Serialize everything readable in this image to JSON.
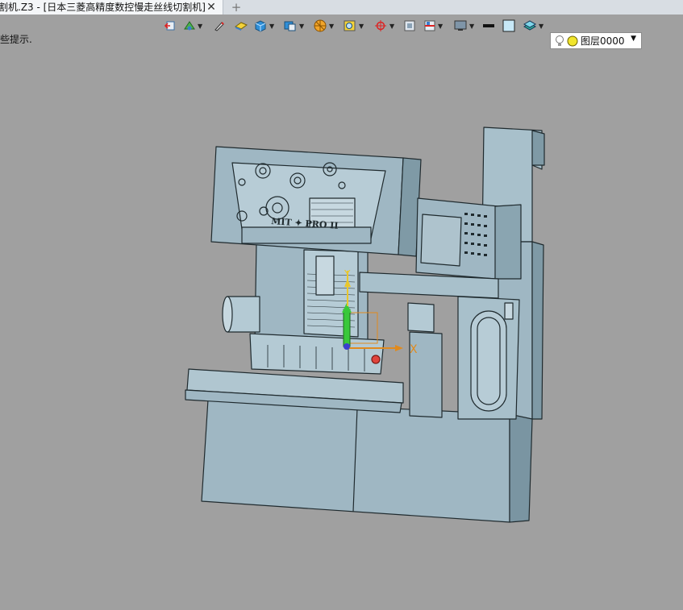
{
  "window": {
    "tab_title": "割机.Z3 - [日本三菱高精度数控慢走丝线切割机]",
    "close_glyph": "✕",
    "new_tab_glyph": "+"
  },
  "statusbar": {
    "hint": "些提示."
  },
  "toolbar": {
    "items": [
      {
        "name": "pick-filter-icon",
        "dropdown": false
      },
      {
        "name": "view-style-icon",
        "dropdown": true
      },
      {
        "name": "pencil-icon",
        "dropdown": false
      },
      {
        "name": "shade-icon",
        "dropdown": false
      },
      {
        "name": "solid-cube-icon",
        "dropdown": true
      },
      {
        "name": "display-mode-icon",
        "dropdown": true
      },
      {
        "name": "render-sphere-icon",
        "dropdown": true
      },
      {
        "name": "zoom-window-icon",
        "dropdown": true
      },
      {
        "name": "target-icon",
        "dropdown": true
      },
      {
        "name": "frame-icon",
        "dropdown": false
      },
      {
        "name": "section-icon",
        "dropdown": true
      },
      {
        "name": "monitor-icon",
        "dropdown": true
      },
      {
        "name": "line-weight-icon",
        "dropdown": false
      },
      {
        "name": "color-swatch-icon",
        "dropdown": false
      },
      {
        "name": "layers-icon",
        "dropdown": true
      }
    ],
    "layer": {
      "label": "图层0000",
      "arrow": "▼"
    }
  },
  "model": {
    "belt_label": "MIT ✦ PRO II",
    "axis_x": "X",
    "axis_y": "Y",
    "colors": {
      "body": "#9fb7c3",
      "edge": "#1f2a2e",
      "axis_x": "#e08a1e",
      "axis_y": "#39c83a",
      "axis_z": "#e9c62c"
    }
  }
}
